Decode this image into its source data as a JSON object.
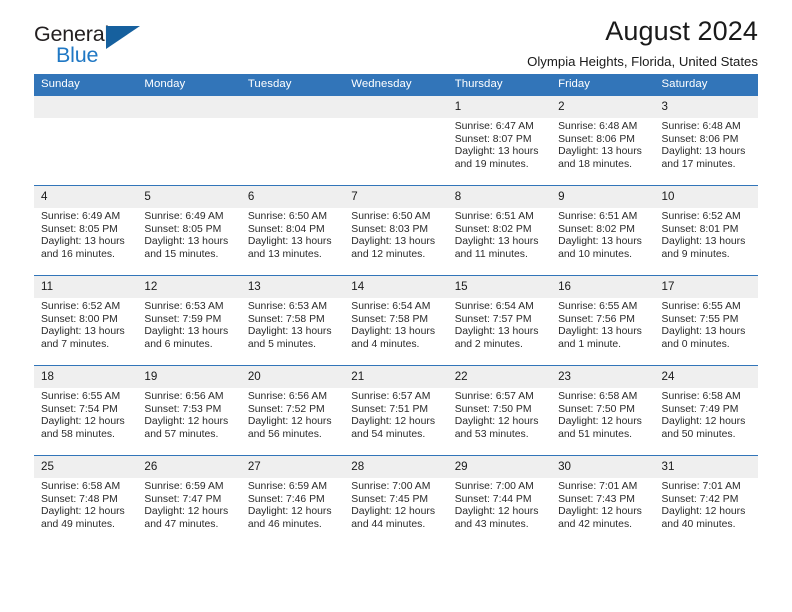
{
  "brand": {
    "line1": "General",
    "line2": "Blue",
    "triangle_color": "#16609e",
    "blue_color": "#2078c4"
  },
  "header": {
    "title": "August 2024",
    "subtitle": "Olympia Heights, Florida, United States"
  },
  "theme": {
    "header_row_bg": "#3275b9",
    "header_row_text": "#ffffff",
    "daynum_bg": "#efefef",
    "row_divider": "#3275b9"
  },
  "calendar": {
    "weekday_headers": [
      "Sunday",
      "Monday",
      "Tuesday",
      "Wednesday",
      "Thursday",
      "Friday",
      "Saturday"
    ],
    "labels": {
      "sunrise": "Sunrise:",
      "sunset": "Sunset:",
      "daylight": "Daylight:"
    },
    "weeks": [
      [
        {
          "empty": true
        },
        {
          "empty": true
        },
        {
          "empty": true
        },
        {
          "empty": true
        },
        {
          "day": "1",
          "sunrise": "Sunrise: 6:47 AM",
          "sunset": "Sunset: 8:07 PM",
          "daylight_1": "Daylight: 13 hours",
          "daylight_2": "and 19 minutes."
        },
        {
          "day": "2",
          "sunrise": "Sunrise: 6:48 AM",
          "sunset": "Sunset: 8:06 PM",
          "daylight_1": "Daylight: 13 hours",
          "daylight_2": "and 18 minutes."
        },
        {
          "day": "3",
          "sunrise": "Sunrise: 6:48 AM",
          "sunset": "Sunset: 8:06 PM",
          "daylight_1": "Daylight: 13 hours",
          "daylight_2": "and 17 minutes."
        }
      ],
      [
        {
          "day": "4",
          "sunrise": "Sunrise: 6:49 AM",
          "sunset": "Sunset: 8:05 PM",
          "daylight_1": "Daylight: 13 hours",
          "daylight_2": "and 16 minutes."
        },
        {
          "day": "5",
          "sunrise": "Sunrise: 6:49 AM",
          "sunset": "Sunset: 8:05 PM",
          "daylight_1": "Daylight: 13 hours",
          "daylight_2": "and 15 minutes."
        },
        {
          "day": "6",
          "sunrise": "Sunrise: 6:50 AM",
          "sunset": "Sunset: 8:04 PM",
          "daylight_1": "Daylight: 13 hours",
          "daylight_2": "and 13 minutes."
        },
        {
          "day": "7",
          "sunrise": "Sunrise: 6:50 AM",
          "sunset": "Sunset: 8:03 PM",
          "daylight_1": "Daylight: 13 hours",
          "daylight_2": "and 12 minutes."
        },
        {
          "day": "8",
          "sunrise": "Sunrise: 6:51 AM",
          "sunset": "Sunset: 8:02 PM",
          "daylight_1": "Daylight: 13 hours",
          "daylight_2": "and 11 minutes."
        },
        {
          "day": "9",
          "sunrise": "Sunrise: 6:51 AM",
          "sunset": "Sunset: 8:02 PM",
          "daylight_1": "Daylight: 13 hours",
          "daylight_2": "and 10 minutes."
        },
        {
          "day": "10",
          "sunrise": "Sunrise: 6:52 AM",
          "sunset": "Sunset: 8:01 PM",
          "daylight_1": "Daylight: 13 hours",
          "daylight_2": "and 9 minutes."
        }
      ],
      [
        {
          "day": "11",
          "sunrise": "Sunrise: 6:52 AM",
          "sunset": "Sunset: 8:00 PM",
          "daylight_1": "Daylight: 13 hours",
          "daylight_2": "and 7 minutes."
        },
        {
          "day": "12",
          "sunrise": "Sunrise: 6:53 AM",
          "sunset": "Sunset: 7:59 PM",
          "daylight_1": "Daylight: 13 hours",
          "daylight_2": "and 6 minutes."
        },
        {
          "day": "13",
          "sunrise": "Sunrise: 6:53 AM",
          "sunset": "Sunset: 7:58 PM",
          "daylight_1": "Daylight: 13 hours",
          "daylight_2": "and 5 minutes."
        },
        {
          "day": "14",
          "sunrise": "Sunrise: 6:54 AM",
          "sunset": "Sunset: 7:58 PM",
          "daylight_1": "Daylight: 13 hours",
          "daylight_2": "and 4 minutes."
        },
        {
          "day": "15",
          "sunrise": "Sunrise: 6:54 AM",
          "sunset": "Sunset: 7:57 PM",
          "daylight_1": "Daylight: 13 hours",
          "daylight_2": "and 2 minutes."
        },
        {
          "day": "16",
          "sunrise": "Sunrise: 6:55 AM",
          "sunset": "Sunset: 7:56 PM",
          "daylight_1": "Daylight: 13 hours",
          "daylight_2": "and 1 minute."
        },
        {
          "day": "17",
          "sunrise": "Sunrise: 6:55 AM",
          "sunset": "Sunset: 7:55 PM",
          "daylight_1": "Daylight: 13 hours",
          "daylight_2": "and 0 minutes."
        }
      ],
      [
        {
          "day": "18",
          "sunrise": "Sunrise: 6:55 AM",
          "sunset": "Sunset: 7:54 PM",
          "daylight_1": "Daylight: 12 hours",
          "daylight_2": "and 58 minutes."
        },
        {
          "day": "19",
          "sunrise": "Sunrise: 6:56 AM",
          "sunset": "Sunset: 7:53 PM",
          "daylight_1": "Daylight: 12 hours",
          "daylight_2": "and 57 minutes."
        },
        {
          "day": "20",
          "sunrise": "Sunrise: 6:56 AM",
          "sunset": "Sunset: 7:52 PM",
          "daylight_1": "Daylight: 12 hours",
          "daylight_2": "and 56 minutes."
        },
        {
          "day": "21",
          "sunrise": "Sunrise: 6:57 AM",
          "sunset": "Sunset: 7:51 PM",
          "daylight_1": "Daylight: 12 hours",
          "daylight_2": "and 54 minutes."
        },
        {
          "day": "22",
          "sunrise": "Sunrise: 6:57 AM",
          "sunset": "Sunset: 7:50 PM",
          "daylight_1": "Daylight: 12 hours",
          "daylight_2": "and 53 minutes."
        },
        {
          "day": "23",
          "sunrise": "Sunrise: 6:58 AM",
          "sunset": "Sunset: 7:50 PM",
          "daylight_1": "Daylight: 12 hours",
          "daylight_2": "and 51 minutes."
        },
        {
          "day": "24",
          "sunrise": "Sunrise: 6:58 AM",
          "sunset": "Sunset: 7:49 PM",
          "daylight_1": "Daylight: 12 hours",
          "daylight_2": "and 50 minutes."
        }
      ],
      [
        {
          "day": "25",
          "sunrise": "Sunrise: 6:58 AM",
          "sunset": "Sunset: 7:48 PM",
          "daylight_1": "Daylight: 12 hours",
          "daylight_2": "and 49 minutes."
        },
        {
          "day": "26",
          "sunrise": "Sunrise: 6:59 AM",
          "sunset": "Sunset: 7:47 PM",
          "daylight_1": "Daylight: 12 hours",
          "daylight_2": "and 47 minutes."
        },
        {
          "day": "27",
          "sunrise": "Sunrise: 6:59 AM",
          "sunset": "Sunset: 7:46 PM",
          "daylight_1": "Daylight: 12 hours",
          "daylight_2": "and 46 minutes."
        },
        {
          "day": "28",
          "sunrise": "Sunrise: 7:00 AM",
          "sunset": "Sunset: 7:45 PM",
          "daylight_1": "Daylight: 12 hours",
          "daylight_2": "and 44 minutes."
        },
        {
          "day": "29",
          "sunrise": "Sunrise: 7:00 AM",
          "sunset": "Sunset: 7:44 PM",
          "daylight_1": "Daylight: 12 hours",
          "daylight_2": "and 43 minutes."
        },
        {
          "day": "30",
          "sunrise": "Sunrise: 7:01 AM",
          "sunset": "Sunset: 7:43 PM",
          "daylight_1": "Daylight: 12 hours",
          "daylight_2": "and 42 minutes."
        },
        {
          "day": "31",
          "sunrise": "Sunrise: 7:01 AM",
          "sunset": "Sunset: 7:42 PM",
          "daylight_1": "Daylight: 12 hours",
          "daylight_2": "and 40 minutes."
        }
      ]
    ]
  }
}
